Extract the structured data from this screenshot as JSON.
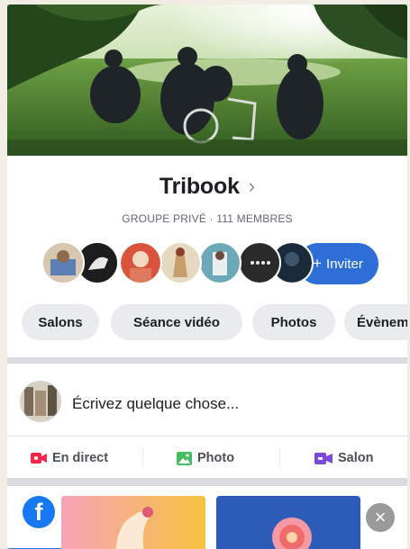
{
  "group": {
    "name": "Tribook",
    "subtitle": "GROUPE PRIVÉ · 111 MEMBRES"
  },
  "invite_button": {
    "label": "Inviter",
    "icon": "plus-icon"
  },
  "tabs": [
    {
      "label": "Salons"
    },
    {
      "label": "Séance vidéo"
    },
    {
      "label": "Photos"
    },
    {
      "label": "Évènements"
    }
  ],
  "composer": {
    "placeholder": "Écrivez quelque chose..."
  },
  "actions": [
    {
      "label": "En direct",
      "icon": "live-video-icon",
      "color": "#f02849"
    },
    {
      "label": "Photo",
      "icon": "photo-icon",
      "color": "#45bd62"
    },
    {
      "label": "Salon",
      "icon": "room-icon",
      "color": "#7b48e0"
    }
  ],
  "stories": {
    "logo": "f",
    "close_icon": "close-icon"
  },
  "colors": {
    "accent": "#2d6fd6",
    "facebook_blue": "#1877f2"
  }
}
